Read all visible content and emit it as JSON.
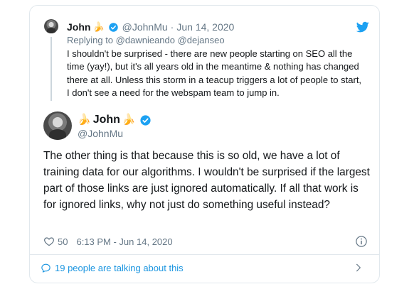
{
  "quoted": {
    "name": "John",
    "emoji": "🍌",
    "handle": "@JohnMu",
    "date": "Jun 14, 2020",
    "separator": "·",
    "replying_prefix": "Replying to",
    "replying_to": "@dawnieando @dejanseo",
    "text": "I shouldn't be surprised - there are new people starting on SEO all the time (yay!), but it's all years old in the meantime & nothing has changed there at all. Unless this storm in a teacup triggers a lot of people to start, I don't see a need for the webspam team to jump in."
  },
  "tweet": {
    "name": "John",
    "emoji": "🍌",
    "handle": "@JohnMu",
    "text": "The other thing is that because this is so old, we have a lot of training data for our algorithms. I wouldn't be surprised if the largest part of those links are just ignored automatically. If all that work is for ignored links, why not just do something useful instead?",
    "likes": "50",
    "timestamp": "6:13 PM - Jun 14, 2020"
  },
  "footer": {
    "talking": "19 people are talking about this"
  },
  "colors": {
    "accent": "#1b95e0",
    "muted": "#657786",
    "verified": "#1da1f2",
    "border": "#e1e8ed"
  },
  "icons": {
    "verified": "verified-badge-icon",
    "twitter": "twitter-bird-icon",
    "heart": "heart-icon",
    "info": "info-icon",
    "comment": "comment-icon",
    "chevron": "chevron-right-icon"
  }
}
